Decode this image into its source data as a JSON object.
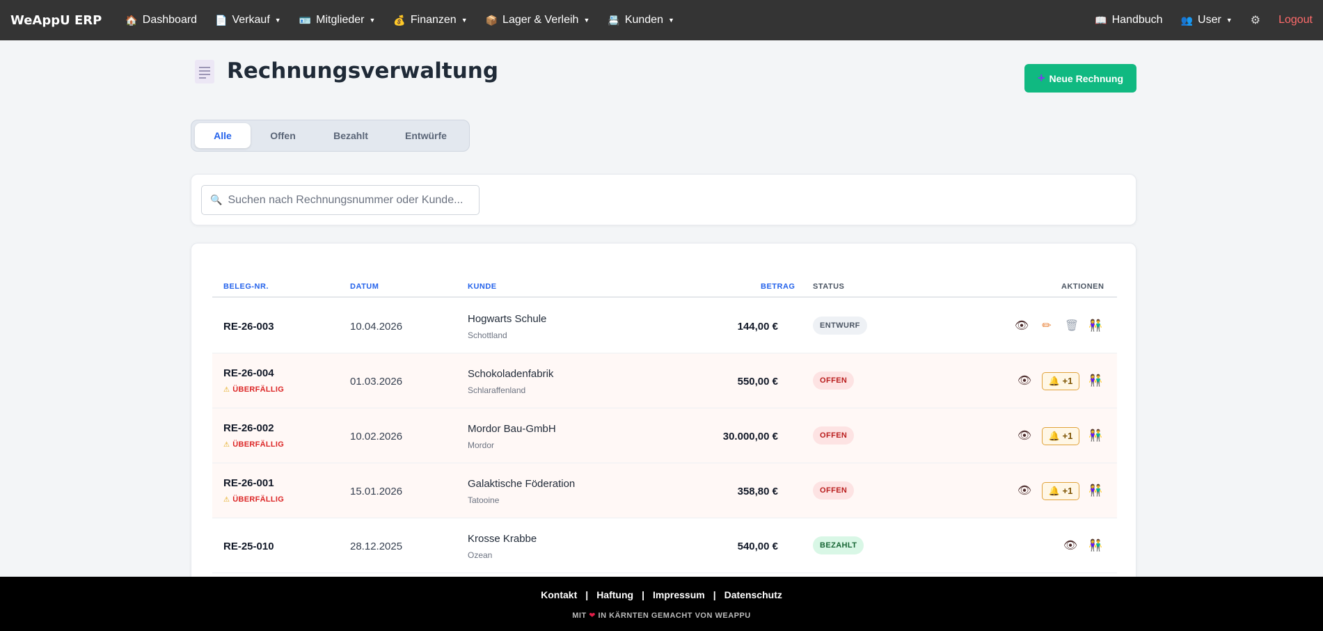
{
  "nav": {
    "brand": "WeAppU ERP",
    "items": [
      {
        "label": "Dashboard",
        "icon": "🏠"
      },
      {
        "label": "Verkauf",
        "icon": "📄"
      },
      {
        "label": "Mitglieder",
        "icon": "🪪"
      },
      {
        "label": "Finanzen",
        "icon": "💰"
      },
      {
        "label": "Lager & Verleih",
        "icon": "📦"
      },
      {
        "label": "Kunden",
        "icon": "📇"
      }
    ],
    "handbuch": "Handbuch",
    "user": "User",
    "logout": "Logout"
  },
  "header": {
    "title": "Rechnungsverwaltung",
    "new_button": "Neue Rechnung"
  },
  "tabs": [
    "Alle",
    "Offen",
    "Bezahlt",
    "Entwürfe"
  ],
  "active_tab": "Alle",
  "search": {
    "placeholder": "Suchen nach Rechnungsnummer oder Kunde..."
  },
  "table": {
    "columns": [
      "BELEG-NR.",
      "DATUM",
      "KUNDE",
      "BETRAG",
      "STATUS",
      "AKTIONEN"
    ],
    "overdue_label": "ÜBERFÄLLIG",
    "reminder_label": "🔔 +1",
    "rows": [
      {
        "nr": "RE-26-003",
        "date": "10.04.2026",
        "customer": "Hogwarts Schule",
        "location": "Schottland",
        "amount": "144,00 €",
        "status": "ENTWURF"
      },
      {
        "nr": "RE-26-004",
        "date": "01.03.2026",
        "customer": "Schokoladenfabrik",
        "location": "Schlaraffenland",
        "amount": "550,00 €",
        "status": "OFFEN"
      },
      {
        "nr": "RE-26-002",
        "date": "10.02.2026",
        "customer": "Mordor Bau-GmbH",
        "location": "Mordor",
        "amount": "30.000,00 €",
        "status": "OFFEN"
      },
      {
        "nr": "RE-26-001",
        "date": "15.01.2026",
        "customer": "Galaktische Föderation",
        "location": "Tatooine",
        "amount": "358,80 €",
        "status": "OFFEN"
      },
      {
        "nr": "RE-25-010",
        "date": "28.12.2025",
        "customer": "Krosse Krabbe",
        "location": "Ozean",
        "amount": "540,00 €",
        "status": "BEZAHLT"
      }
    ]
  },
  "footer": {
    "links": [
      "Kontakt",
      "Haftung",
      "Impressum",
      "Datenschutz"
    ],
    "separator": "|",
    "made_prefix": "MIT",
    "made_suffix": "IN KÄRNTEN GEMACHT VON WEAPPU"
  }
}
